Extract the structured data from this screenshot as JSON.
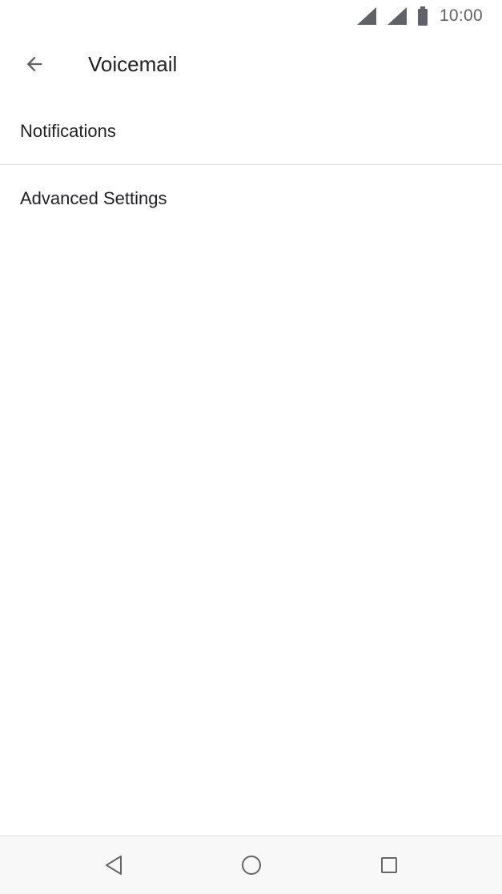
{
  "status_bar": {
    "time": "10:00",
    "icons": [
      "wifi-signal-icon",
      "cell-signal-icon",
      "battery-icon"
    ]
  },
  "toolbar": {
    "back_icon": "arrow-back-icon",
    "title": "Voicemail"
  },
  "settings": {
    "items": [
      {
        "label": "Notifications"
      },
      {
        "label": "Advanced Settings"
      }
    ]
  },
  "nav_bar": {
    "icons": [
      "nav-back-icon",
      "nav-home-icon",
      "nav-recents-icon"
    ]
  },
  "colors": {
    "text_primary": "#202124",
    "divider": "#dadce0",
    "nav_background": "#f8f8f8"
  }
}
